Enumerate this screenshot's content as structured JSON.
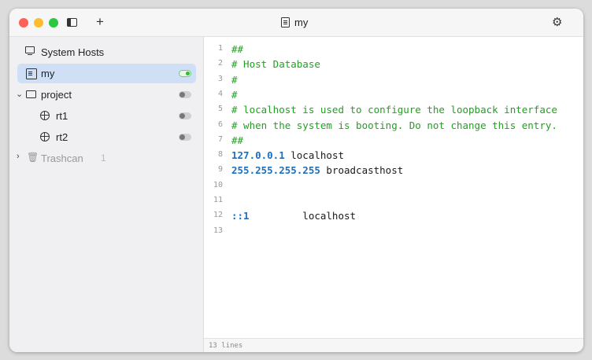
{
  "window": {
    "title": "my"
  },
  "toolbar": {
    "add_label": "+"
  },
  "sidebar": {
    "items": [
      {
        "label": "System Hosts",
        "icon": "monitor-icon"
      },
      {
        "label": "my",
        "icon": "doc-icon",
        "enabled": true
      },
      {
        "label": "project",
        "icon": "folder-icon",
        "enabled": false,
        "expanded": true
      },
      {
        "label": "rt1",
        "icon": "globe-icon",
        "enabled": false
      },
      {
        "label": "rt2",
        "icon": "globe-icon",
        "enabled": false
      },
      {
        "label": "Trashcan",
        "icon": "trash-icon",
        "count": "1"
      }
    ]
  },
  "editor": {
    "lines": [
      {
        "n": "1",
        "text": "##",
        "kind": "comment"
      },
      {
        "n": "2",
        "text": "# Host Database",
        "kind": "comment"
      },
      {
        "n": "3",
        "text": "#",
        "kind": "comment"
      },
      {
        "n": "4",
        "text": "#",
        "kind": "comment"
      },
      {
        "n": "5",
        "text": "# localhost is used to configure the loopback interface",
        "kind": "comment"
      },
      {
        "n": "6",
        "text": "# when the system is booting. Do not change this entry.",
        "kind": "comment"
      },
      {
        "n": "7",
        "text": "##",
        "kind": "comment"
      },
      {
        "n": "8",
        "ip": "127.0.0.1",
        "host": " localhost",
        "kind": "entry"
      },
      {
        "n": "9",
        "ip": "255.255.255.255",
        "host": " broadcasthost",
        "kind": "entry"
      },
      {
        "n": "10",
        "text": "",
        "kind": "blank"
      },
      {
        "n": "11",
        "text": "",
        "kind": "blank"
      },
      {
        "n": "12",
        "ip": "::1",
        "host": "         localhost",
        "kind": "entry"
      },
      {
        "n": "13",
        "text": "",
        "kind": "blank"
      }
    ]
  },
  "status": {
    "line_count": "13 lines"
  },
  "colors": {
    "comment": "#22a022",
    "ip": "#1a6fc0",
    "selection": "#cfe0f6"
  }
}
